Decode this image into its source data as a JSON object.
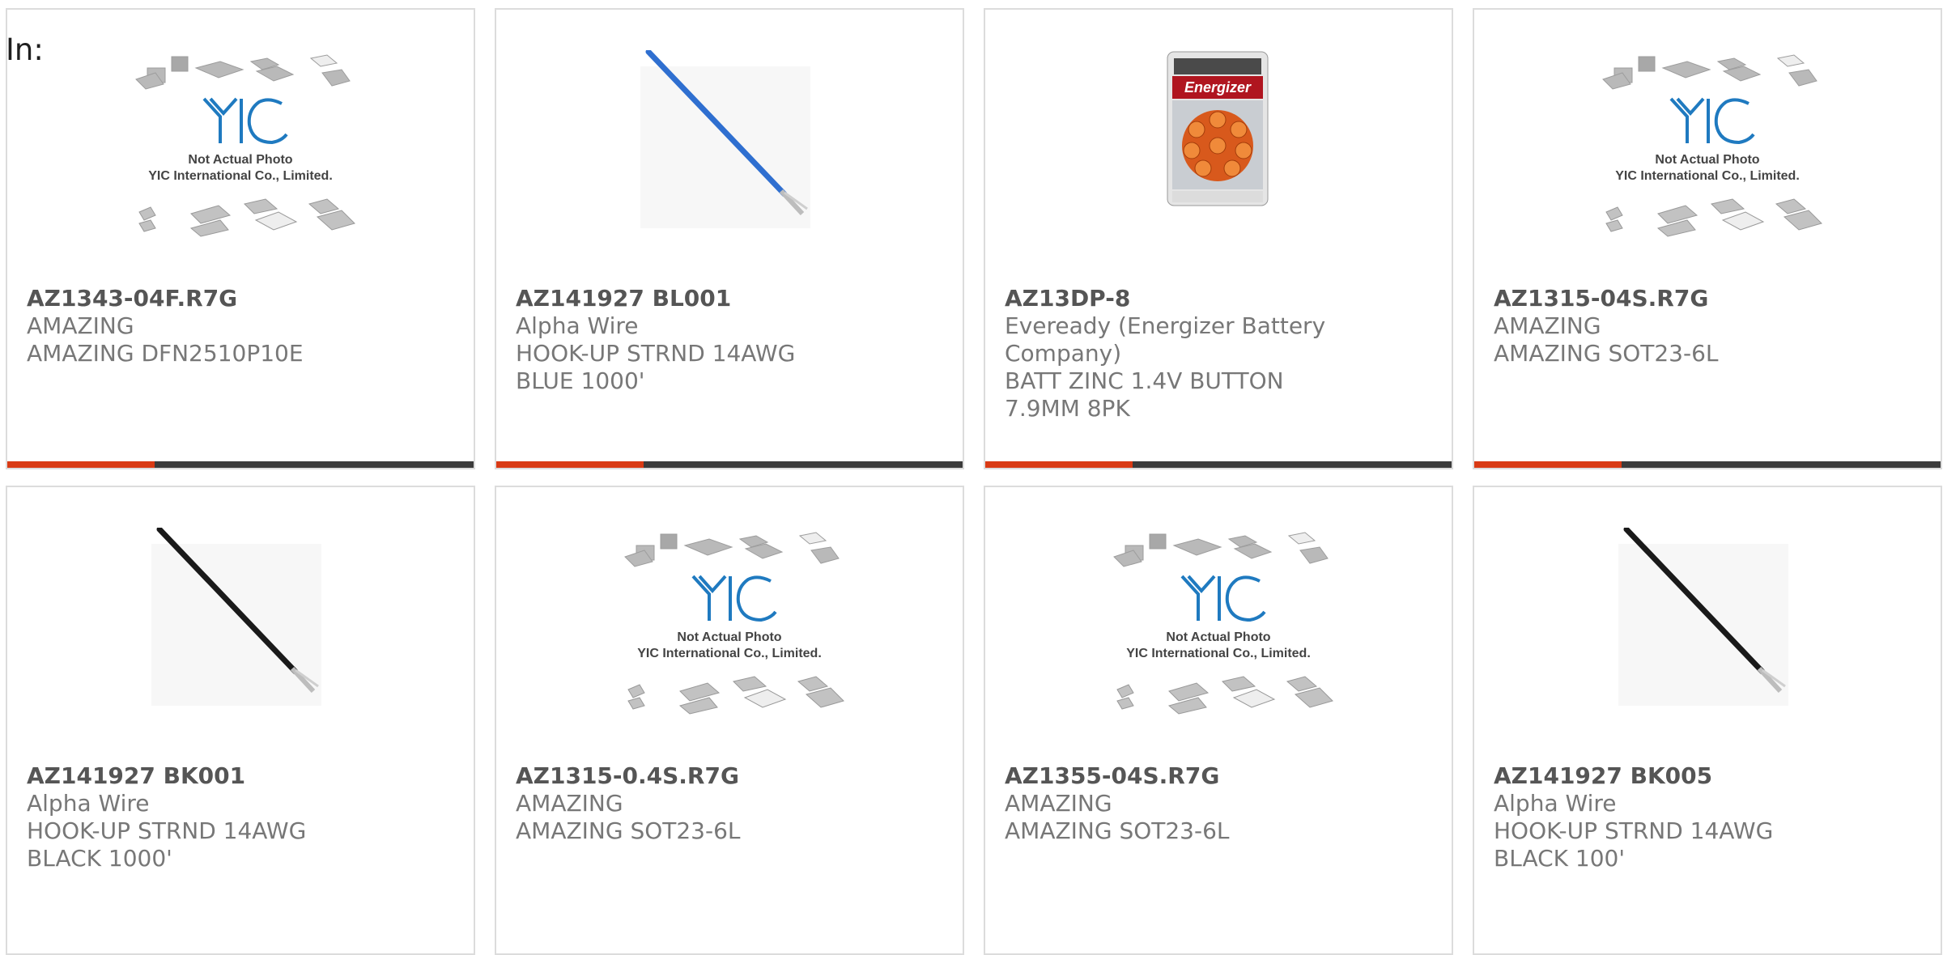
{
  "header": {
    "label": "In:"
  },
  "products": [
    {
      "part_number": "AZ1343-04F.R7G",
      "manufacturer": "AMAZING",
      "description": "AMAZING DFN2510P10E",
      "image": "placeholder-yic-logo"
    },
    {
      "part_number": "AZ141927 BL001",
      "manufacturer": "Alpha Wire",
      "description": "HOOK-UP STRND 14AWG BLUE 1000'",
      "image": "blue-wire"
    },
    {
      "part_number": "AZ13DP-8",
      "manufacturer": "Eveready (Energizer Battery Company)",
      "description": "BATT ZINC 1.4V BUTTON 7.9MM 8PK",
      "image": "energizer-battery-pack"
    },
    {
      "part_number": "AZ1315-04S.R7G",
      "manufacturer": "AMAZING",
      "description": "AMAZING SOT23-6L",
      "image": "placeholder-yic-logo"
    },
    {
      "part_number": "AZ141927 BK001",
      "manufacturer": "Alpha Wire",
      "description": "HOOK-UP STRND 14AWG BLACK 1000'",
      "image": "black-wire"
    },
    {
      "part_number": "AZ1315-0.4S.R7G",
      "manufacturer": "AMAZING",
      "description": "AMAZING SOT23-6L",
      "image": "placeholder-yic-logo"
    },
    {
      "part_number": "AZ1355-04S.R7G",
      "manufacturer": "AMAZING",
      "description": "AMAZING SOT23-6L",
      "image": "placeholder-yic-logo"
    },
    {
      "part_number": "AZ141927 BK005",
      "manufacturer": "Alpha Wire",
      "description": "HOOK-UP STRND 14AWG BLACK 100'",
      "image": "black-wire"
    }
  ],
  "placeholder": {
    "line1": "Not Actual Photo",
    "line2": "YIC International Co., Limited.",
    "logo": "YIC"
  },
  "battery": {
    "brand": "Energizer"
  },
  "colors": {
    "accent": "#d93a14",
    "bar": "#3b3b3b",
    "border": "#dcdcdc",
    "blue_wire": "#2f6fd0",
    "black_wire": "#1a1a1a"
  }
}
